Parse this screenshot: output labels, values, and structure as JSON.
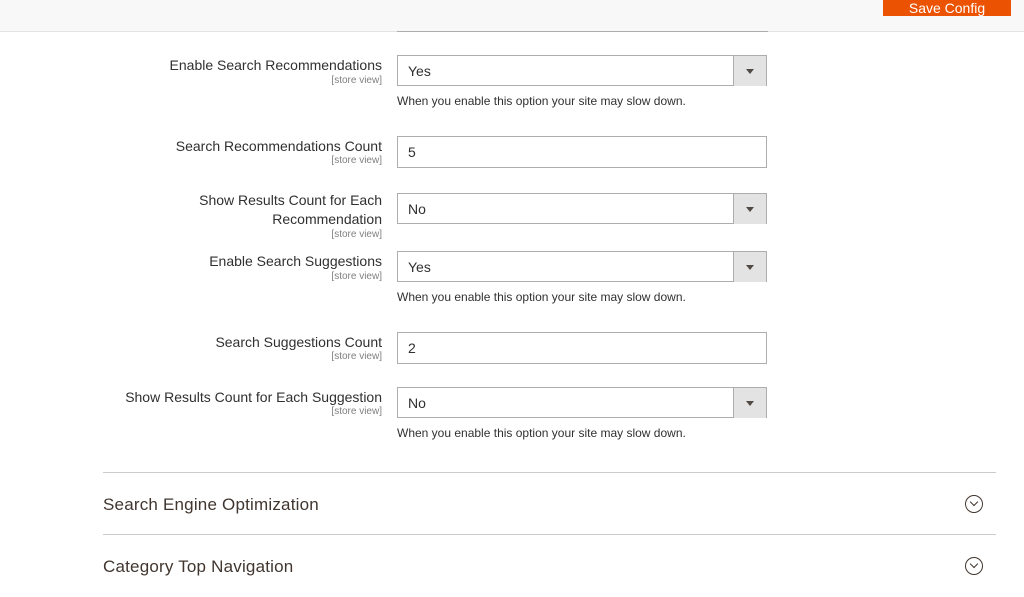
{
  "header": {
    "save_label": "Save Config"
  },
  "fields": [
    {
      "label": "Enable Search Recommendations",
      "scope": "[store view]",
      "type": "select",
      "value": "Yes",
      "note": "When you enable this option your site may slow down."
    },
    {
      "label": "Search Recommendations Count",
      "scope": "[store view]",
      "type": "text",
      "value": "5"
    },
    {
      "label_line1": "Show Results Count for Each",
      "label_line2": "Recommendation",
      "scope": "[store view]",
      "type": "select",
      "value": "No"
    },
    {
      "label": "Enable Search Suggestions",
      "scope": "[store view]",
      "type": "select",
      "value": "Yes",
      "note": "When you enable this option your site may slow down."
    },
    {
      "label": "Search Suggestions Count",
      "scope": "[store view]",
      "type": "text",
      "value": "2"
    },
    {
      "label": "Show Results Count for Each Suggestion",
      "scope": "[store view]",
      "type": "select",
      "value": "No",
      "note": "When you enable this option your site may slow down."
    }
  ],
  "sections": [
    {
      "title": "Search Engine Optimization",
      "icon": "chevron-down-circle-icon"
    },
    {
      "title": "Category Top Navigation",
      "icon": "chevron-down-circle-icon"
    }
  ],
  "colors": {
    "accent": "#eb5202",
    "border": "#adadad",
    "text": "#303030",
    "scope_text": "#808080"
  }
}
